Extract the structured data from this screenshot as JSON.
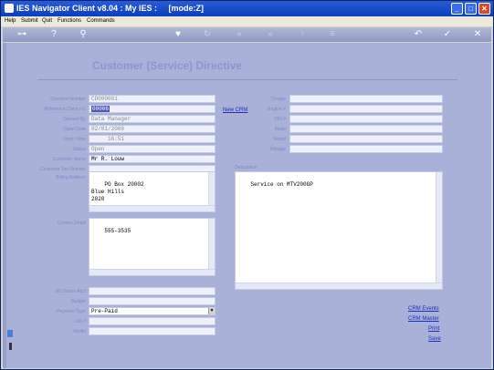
{
  "window": {
    "title": "IES Navigator Client v8.04 : My IES :     [mode:Z]"
  },
  "menu": [
    "Help",
    "Submit",
    "Quit",
    "Functions",
    "Commands"
  ],
  "page": {
    "heading": "Customer (Service) Directive"
  },
  "form": {
    "labels": {
      "directive_number": "Directive Number",
      "reference": "Reference Client no.",
      "opened_by": "Opened By",
      "open_date": "Open Date",
      "open_time": "Open Time",
      "status": "Status",
      "customer_name": "Customer Name",
      "customer_tax": "Customer Tax Number",
      "billing_address": "Billing Address",
      "contact_detail": "Contact Detail",
      "alt_debtor": "Alt Debtor Acct",
      "budget": "Budget",
      "payment_type": "Payment Type",
      "list": "List #",
      "model": "Model"
    },
    "values": {
      "directive_number": "CD000001",
      "reference": "00006",
      "opened_by": "Data Manager",
      "open_date": "02/01/2008",
      "open_time": "16:51",
      "status": "Open",
      "customer_name": "Mr R. Louw",
      "billing_address": "PO Box 20002\nBlue Hills\n2020",
      "contact_detail": "555-3535",
      "payment_type": "Pre-Paid"
    }
  },
  "right": {
    "new_crm": "New CRM",
    "labels": {
      "charge": "Charge",
      "engine": "Engine #",
      "vin": "VIN #",
      "make": "Make",
      "model": "Model",
      "mileage": "Mileage"
    },
    "description_label": "Description",
    "description": "Service on MTV200GP"
  },
  "links": {
    "crm_events": "CRM Events",
    "crm_master": "CRM Master",
    "print": "Print",
    "save": "Save"
  }
}
